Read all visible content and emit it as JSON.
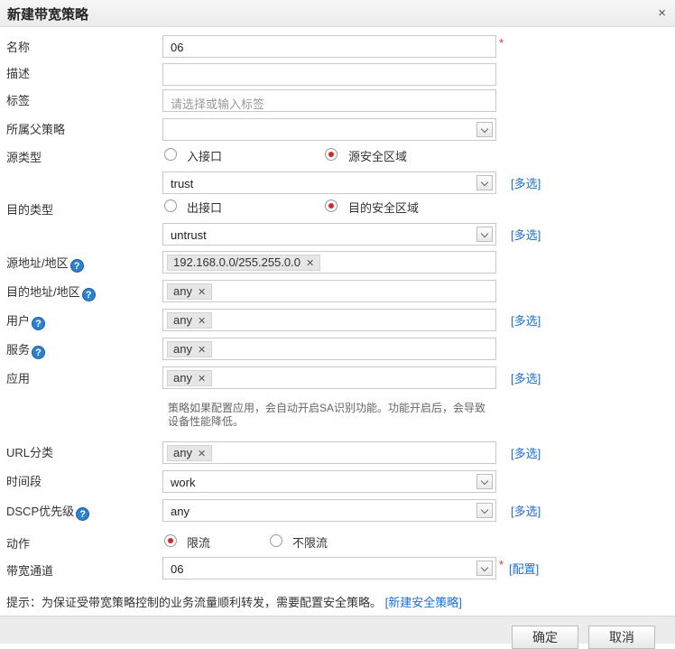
{
  "dialog": {
    "title": "新建带宽策略",
    "close": "×"
  },
  "form": {
    "name": {
      "label": "名称",
      "value": "06",
      "required": "*"
    },
    "description": {
      "label": "描述",
      "value": ""
    },
    "tags": {
      "label": "标签",
      "placeholder": "请选择或输入标签"
    },
    "parent_policy": {
      "label": "所属父策略",
      "value": ""
    },
    "source_type": {
      "label": "源类型",
      "option_interface": "入接口",
      "option_zone": "源安全区域",
      "selected": "源安全区域",
      "zone_value": "trust",
      "multi_link": "[多选]"
    },
    "dest_type": {
      "label": "目的类型",
      "option_interface": "出接口",
      "option_zone": "目的安全区域",
      "selected": "目的安全区域",
      "zone_value": "untrust",
      "multi_link": "[多选]"
    },
    "source_address": {
      "label": "源地址/地区",
      "tag": "192.168.0.0/255.255.0.0"
    },
    "dest_address": {
      "label": "目的地址/地区",
      "tag": "any"
    },
    "user": {
      "label": "用户",
      "tag": "any",
      "multi_link": "[多选]"
    },
    "service": {
      "label": "服务",
      "tag": "any"
    },
    "application": {
      "label": "应用",
      "tag": "any",
      "multi_link": "[多选]",
      "note": "策略如果配置应用，会自动开启SA识别功能。功能开启后，会导致设备性能降低。"
    },
    "url_category": {
      "label": "URL分类",
      "tag": "any",
      "multi_link": "[多选]"
    },
    "time_range": {
      "label": "时间段",
      "value": "work"
    },
    "dscp": {
      "label": "DSCP优先级",
      "value": "any",
      "multi_link": "[多选]"
    },
    "action": {
      "label": "动作",
      "option_limit": "限流",
      "option_nolimit": "不限流",
      "selected": "限流"
    },
    "bandwidth_channel": {
      "label": "带宽通道",
      "value": "06",
      "required": "*",
      "config_link": "[配置]"
    }
  },
  "hint": {
    "text": "提示：为保证受带宽策略控制的业务流量顺利转发，需要配置安全策略。",
    "link": "[新建安全策略]"
  },
  "help_glyph": "?",
  "remove_glyph": "✕",
  "buttons": {
    "ok": "确定",
    "cancel": "取消"
  },
  "colors": {
    "accent_link": "#1a6fd1",
    "radio_selected": "#d22a2a",
    "required": "#e03030",
    "help_icon": "#2f7fd0"
  }
}
